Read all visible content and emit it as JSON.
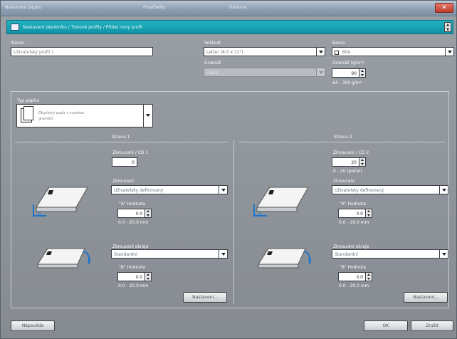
{
  "window": {
    "title_segments": [
      "Nastavení papíru",
      "Prostředky",
      "Tiskárna"
    ],
    "close_glyph": "✕"
  },
  "nav": {
    "path": "Nastavení zásobníku / Tiskové profily / Přidat nový profil",
    "scroll_up": "▲",
    "scroll_down": "▼"
  },
  "colors": {
    "accent": "#1aa5b6",
    "window_bg": "#8f9499",
    "field_bg": "#ffffff",
    "label": "#ffffff"
  },
  "form": {
    "name_label": "Název",
    "name_value": "Uživatelský profil 1",
    "size_label": "Velikost",
    "size_value": "Letter (8.5 x 11\")",
    "color_label": "Barva",
    "color_value": "Bílá",
    "weight_label": "Gramáž",
    "weight_value": "Zadat",
    "gsm_label": "Gramáž (g/m²)",
    "gsm_value": "90",
    "gsm_range": "64 - 300 g/m²"
  },
  "paper_type": {
    "label": "Typ papíru",
    "line1": "Obyčejný papír s vysokou",
    "line2": "gramáží"
  },
  "side1": {
    "header": "Strana 1",
    "count_label": "Zkroucení / CD 1",
    "count_value": "0",
    "combo1_label": "Zkroucení",
    "combo1_value": "Uživatelsky definovaný",
    "a_label": "\"A\" Hodnota",
    "a_value": "0.0",
    "a_range": "0.0 - 20.0 mm",
    "combo2_label": "Zkroucení okraje",
    "combo2_value": "Standardní",
    "b_label": "\"B\" Hodnota",
    "b_value": "0.0",
    "b_range": "0.0 - 20.0 mm",
    "button": "Nastavení..."
  },
  "side2": {
    "header": "Strana 2",
    "count_label": "Zkroucení / CD 2",
    "count_value": "20",
    "count_range": "0 - 20 (počet)",
    "combo1_label": "Zkroucení",
    "combo1_value": "Uživatelsky definovaný",
    "a_label": "\"A\" Hodnota",
    "a_value": "0.0",
    "a_range": "0.0 - 20.0 mm",
    "combo2_label": "Zkroucení okraje",
    "combo2_value": "Standardní",
    "b_label": "\"B\" Hodnota",
    "b_value": "0.0",
    "b_range": "0.0 - 20.0 mm",
    "button": "Nastavení..."
  },
  "footer": {
    "help": "Nápověda",
    "ok": "OK",
    "cancel": "Zrušit"
  }
}
